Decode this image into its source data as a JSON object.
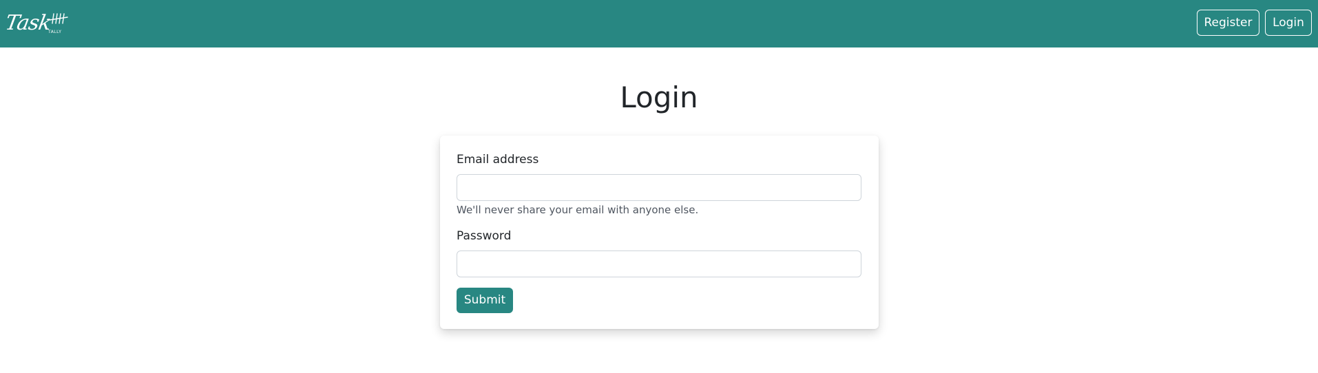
{
  "brand": {
    "logo_text": "Task",
    "logo_subtext": "TALLY",
    "logo_icon": "tally-marks-icon"
  },
  "nav": {
    "register_label": "Register",
    "login_label": "Login"
  },
  "page": {
    "title": "Login"
  },
  "form": {
    "email_label": "Email address",
    "email_value": "",
    "email_help": "We'll never share your email with anyone else.",
    "password_label": "Password",
    "password_value": "",
    "submit_label": "Submit"
  },
  "colors": {
    "primary": "#288782",
    "nav_text": "#ffffff",
    "body_text": "#212529",
    "muted_text": "#4f5660",
    "input_border": "#ced4da"
  }
}
